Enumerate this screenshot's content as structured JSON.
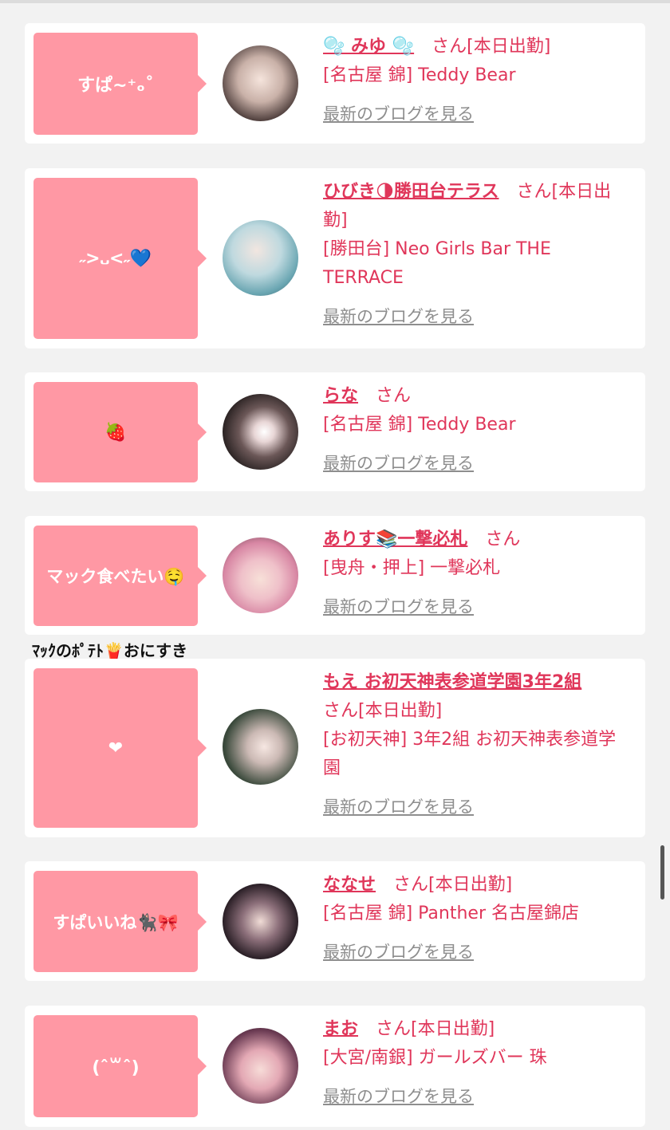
{
  "caption": "ﾏｯｸのﾎﾟﾃﾄ🍟おにすき",
  "entries": [
    {
      "bubble": "すぱ~⁺ₒ˚",
      "name": "🫧 みゆ 🫧",
      "san": "さん",
      "status": "[本日出勤]",
      "shop": "[名古屋 錦] Teddy Bear",
      "blog": "最新のブログを見る"
    },
    {
      "bubble": "˶>᎑<˶💙",
      "name": "ひびき🌗勝田台テラス",
      "san": "さん",
      "status": "[本日出勤]",
      "shop": "[勝田台] Neo Girls Bar THE TERRACE",
      "blog": "最新のブログを見る"
    },
    {
      "bubble": "🍓",
      "name": "らな",
      "san": "さん",
      "status": "",
      "shop": "[名古屋 錦] Teddy Bear",
      "blog": "最新のブログを見る"
    },
    {
      "bubble": "マック食べたい🤤",
      "name": "ありす📚一撃必札",
      "san": "さん",
      "status": "",
      "shop": "[曳舟・押上] 一撃必札",
      "blog": "最新のブログを見る"
    },
    {
      "bubble": "❤",
      "name": "もえ お初天神表参道学園3年2組",
      "san": "さん",
      "status": "[本日出勤]",
      "shop": "[お初天神] 3年2組 お初天神表参道学園",
      "blog": "最新のブログを見る"
    },
    {
      "bubble": "すぱいいね🐈‍⬛🎀",
      "name": "ななせ",
      "san": "さん",
      "status": "[本日出勤]",
      "shop": "[名古屋 錦] Panther 名古屋錦店",
      "blog": "最新のブログを見る"
    },
    {
      "bubble": "(ˆ꒳ˆ)",
      "name": "まお",
      "san": "さん",
      "status": "[本日出勤]",
      "shop": "[大宮/南銀] ガールズバー 珠",
      "blog": "最新のブログを見る"
    }
  ],
  "colors": {
    "accent": "#e0365a",
    "bubble": "#ff98a4",
    "link_gray": "#8e8e8e"
  }
}
